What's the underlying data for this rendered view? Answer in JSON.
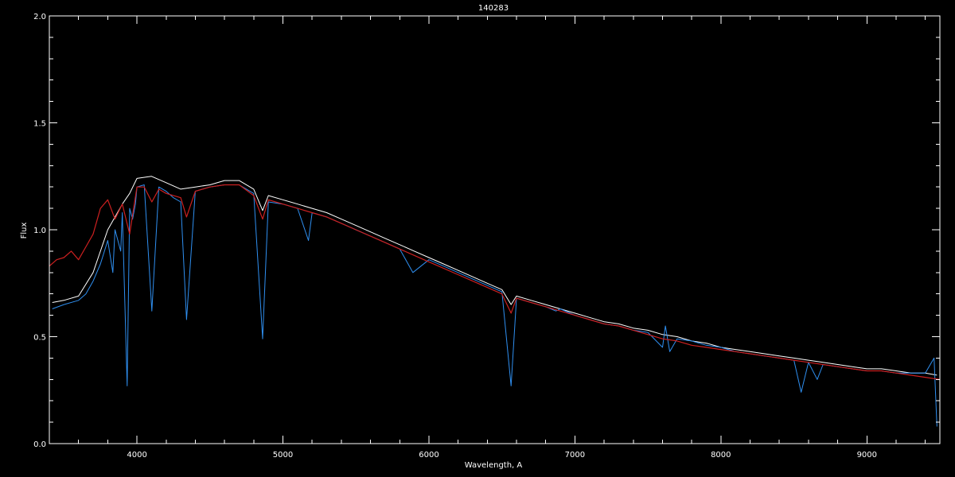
{
  "chart_data": {
    "type": "line",
    "title": "140283",
    "xlabel": "Wavelength, A",
    "ylabel": "Flux",
    "xlim": [
      3400,
      9500
    ],
    "ylim": [
      0.0,
      2.0
    ],
    "grid": false,
    "legend": "none",
    "x_ticks": [
      4000,
      5000,
      6000,
      7000,
      8000,
      9000
    ],
    "x_tick_labels": [
      "4000",
      "5000",
      "6000",
      "7000",
      "8000",
      "9000"
    ],
    "y_ticks": [
      0.0,
      0.5,
      1.0,
      1.5,
      2.0
    ],
    "y_tick_labels": [
      "0.0",
      "0.5",
      "1.0",
      "1.5",
      "2.0"
    ],
    "colors": {
      "background": "#000000",
      "axes": "#ffffff",
      "spectrum_white": "#ffffff",
      "spectrum_blue": "#2f8ff0",
      "model_red": "#cc2020"
    },
    "series": [
      {
        "color": "#ffffff",
        "x": [
          3420,
          3500,
          3600,
          3700,
          3800,
          3900,
          3950,
          4000,
          4100,
          4200,
          4300,
          4400,
          4500,
          4600,
          4700,
          4800,
          4861,
          4900,
          5000,
          5100,
          5200,
          5300,
          5400,
          5500,
          5600,
          5700,
          5800,
          5900,
          6000,
          6100,
          6200,
          6300,
          6400,
          6500,
          6563,
          6600,
          6700,
          6800,
          6900,
          7000,
          7100,
          7200,
          7300,
          7400,
          7500,
          7600,
          7700,
          7800,
          7900,
          8000,
          8100,
          8200,
          8300,
          8400,
          8500,
          8600,
          8700,
          8800,
          8900,
          9000,
          9100,
          9200,
          9300,
          9400,
          9480
        ],
        "y": [
          0.66,
          0.67,
          0.69,
          0.8,
          1.0,
          1.12,
          1.17,
          1.24,
          1.25,
          1.22,
          1.19,
          1.2,
          1.21,
          1.23,
          1.23,
          1.19,
          1.09,
          1.16,
          1.14,
          1.12,
          1.1,
          1.08,
          1.05,
          1.02,
          0.99,
          0.96,
          0.93,
          0.9,
          0.87,
          0.84,
          0.81,
          0.78,
          0.75,
          0.72,
          0.65,
          0.69,
          0.67,
          0.65,
          0.63,
          0.61,
          0.59,
          0.57,
          0.56,
          0.54,
          0.53,
          0.51,
          0.5,
          0.48,
          0.47,
          0.45,
          0.44,
          0.43,
          0.42,
          0.41,
          0.4,
          0.39,
          0.38,
          0.37,
          0.36,
          0.35,
          0.35,
          0.34,
          0.33,
          0.33,
          0.32
        ]
      },
      {
        "color": "#2f8ff0",
        "x": [
          3420,
          3500,
          3600,
          3650,
          3700,
          3750,
          3800,
          3835,
          3850,
          3889,
          3900,
          3933,
          3950,
          3970,
          3990,
          4000,
          4050,
          4102,
          4150,
          4200,
          4250,
          4300,
          4340,
          4400,
          4500,
          4600,
          4700,
          4800,
          4861,
          4900,
          5000,
          5100,
          5175,
          5200,
          5300,
          5400,
          5500,
          5600,
          5700,
          5800,
          5890,
          6000,
          6100,
          6200,
          6300,
          6400,
          6500,
          6563,
          6600,
          6700,
          6800,
          6870,
          6900,
          7000,
          7100,
          7200,
          7300,
          7400,
          7500,
          7600,
          7620,
          7650,
          7700,
          7800,
          7900,
          8000,
          8100,
          8200,
          8300,
          8400,
          8500,
          8550,
          8600,
          8660,
          8700,
          8800,
          8900,
          9000,
          9100,
          9200,
          9300,
          9400,
          9460,
          9480
        ],
        "y": [
          0.63,
          0.65,
          0.67,
          0.7,
          0.76,
          0.84,
          0.95,
          0.8,
          1.0,
          0.9,
          1.08,
          0.27,
          1.1,
          1.05,
          1.12,
          1.2,
          1.21,
          0.62,
          1.2,
          1.18,
          1.15,
          1.13,
          0.58,
          1.18,
          1.2,
          1.21,
          1.21,
          1.17,
          0.49,
          1.13,
          1.12,
          1.1,
          0.95,
          1.08,
          1.06,
          1.03,
          1.0,
          0.97,
          0.94,
          0.91,
          0.8,
          0.86,
          0.83,
          0.8,
          0.77,
          0.74,
          0.71,
          0.27,
          0.68,
          0.66,
          0.64,
          0.62,
          0.63,
          0.6,
          0.58,
          0.56,
          0.55,
          0.53,
          0.52,
          0.45,
          0.55,
          0.43,
          0.49,
          0.48,
          0.46,
          0.45,
          0.43,
          0.42,
          0.41,
          0.4,
          0.39,
          0.24,
          0.38,
          0.3,
          0.37,
          0.36,
          0.35,
          0.34,
          0.34,
          0.33,
          0.33,
          0.33,
          0.4,
          0.08
        ]
      },
      {
        "color": "#cc2020",
        "x": [
          3400,
          3450,
          3500,
          3550,
          3600,
          3650,
          3700,
          3750,
          3800,
          3850,
          3900,
          3950,
          4000,
          4050,
          4102,
          4150,
          4200,
          4300,
          4340,
          4400,
          4500,
          4600,
          4700,
          4800,
          4861,
          4900,
          5000,
          5100,
          5200,
          5300,
          5400,
          5500,
          5600,
          5700,
          5800,
          5900,
          6000,
          6100,
          6200,
          6300,
          6400,
          6500,
          6563,
          6600,
          6700,
          6800,
          6900,
          7000,
          7100,
          7200,
          7300,
          7400,
          7500,
          7600,
          7700,
          7800,
          7900,
          8000,
          8100,
          8200,
          8300,
          8400,
          8500,
          8600,
          8700,
          8800,
          8900,
          9000,
          9100,
          9200,
          9300,
          9400,
          9500
        ],
        "y": [
          0.83,
          0.86,
          0.87,
          0.9,
          0.86,
          0.92,
          0.98,
          1.1,
          1.14,
          1.05,
          1.12,
          0.98,
          1.2,
          1.2,
          1.13,
          1.19,
          1.17,
          1.15,
          1.06,
          1.18,
          1.2,
          1.21,
          1.21,
          1.16,
          1.05,
          1.14,
          1.12,
          1.1,
          1.08,
          1.06,
          1.03,
          1.0,
          0.97,
          0.94,
          0.91,
          0.88,
          0.85,
          0.82,
          0.79,
          0.76,
          0.73,
          0.7,
          0.61,
          0.68,
          0.66,
          0.64,
          0.62,
          0.6,
          0.58,
          0.56,
          0.55,
          0.53,
          0.51,
          0.49,
          0.48,
          0.46,
          0.45,
          0.44,
          0.43,
          0.42,
          0.41,
          0.4,
          0.39,
          0.38,
          0.37,
          0.36,
          0.35,
          0.34,
          0.34,
          0.33,
          0.32,
          0.31,
          0.3
        ]
      }
    ]
  }
}
